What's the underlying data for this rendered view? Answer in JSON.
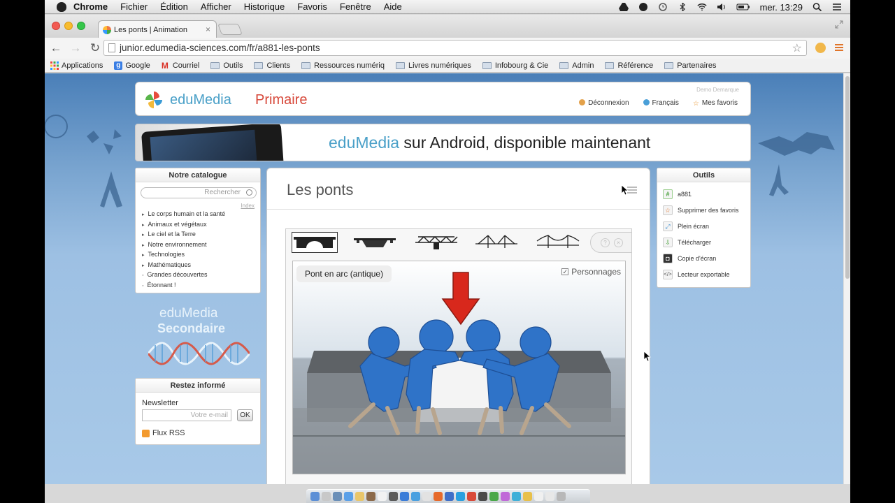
{
  "menubar": {
    "app": "Chrome",
    "items": [
      "Fichier",
      "Édition",
      "Afficher",
      "Historique",
      "Favoris",
      "Fenêtre",
      "Aide"
    ],
    "clock": "mer. 13:29"
  },
  "browser": {
    "tab_title": "Les ponts | Animation",
    "tab_close": "×",
    "url": "junior.edumedia-sciences.com/fr/a881-les-ponts",
    "bookmarks": [
      "Applications",
      "Google",
      "Courriel",
      "Outils",
      "Clients",
      "Ressources numériq",
      "Livres numériques",
      "Infobourg & Cie",
      "Admin",
      "Référence",
      "Partenaires"
    ]
  },
  "header": {
    "brand": "eduMedia",
    "brand_sub": "Primaire",
    "demo_user": "Demo Demarque",
    "links": {
      "logout": "Déconnexion",
      "language": "Français",
      "favorites": "Mes favoris"
    }
  },
  "banner": {
    "brand": "eduMedia",
    "text": " sur Android, disponible maintenant"
  },
  "catalog": {
    "title": "Notre catalogue",
    "search_placeholder": "Rechercher",
    "index_link": "Index",
    "items": [
      "Le corps humain et la santé",
      "Animaux et végétaux",
      "Le ciel et la Terre",
      "Notre environnement",
      "Technologies",
      "Mathématiques",
      "Grandes découvertes",
      "Étonnant !"
    ]
  },
  "secondaire": {
    "line1": "eduMedia",
    "line2": "Secondaire"
  },
  "newsletter": {
    "title": "Restez informé",
    "label": "Newsletter",
    "placeholder": "Votre e-mail",
    "ok": "OK",
    "rss": "Flux RSS"
  },
  "main": {
    "title": "Les ponts",
    "scene_label": "Pont en arc (antique)",
    "checkbox_label": "Personnages",
    "checkbox_checked": true
  },
  "tools": {
    "title": "Outils",
    "items": [
      {
        "label": "a881",
        "icon": "hash-icon",
        "color": "#4aa23c"
      },
      {
        "label": "Supprimer des favoris",
        "icon": "star-icon",
        "color": "#e0742c"
      },
      {
        "label": "Plein écran",
        "icon": "fullscreen-icon",
        "color": "#3d8fd0"
      },
      {
        "label": "Télécharger",
        "icon": "download-icon",
        "color": "#4aa23c"
      },
      {
        "label": "Copie d'écran",
        "icon": "camera-icon",
        "color": "#333333"
      },
      {
        "label": "Lecteur exportable",
        "icon": "code-icon",
        "color": "#555555"
      }
    ]
  },
  "colors": {
    "brand_blue": "#4aa0c8",
    "brand_red": "#d7483a",
    "arrow_red": "#d8281c",
    "figure_blue": "#2f73c8"
  }
}
